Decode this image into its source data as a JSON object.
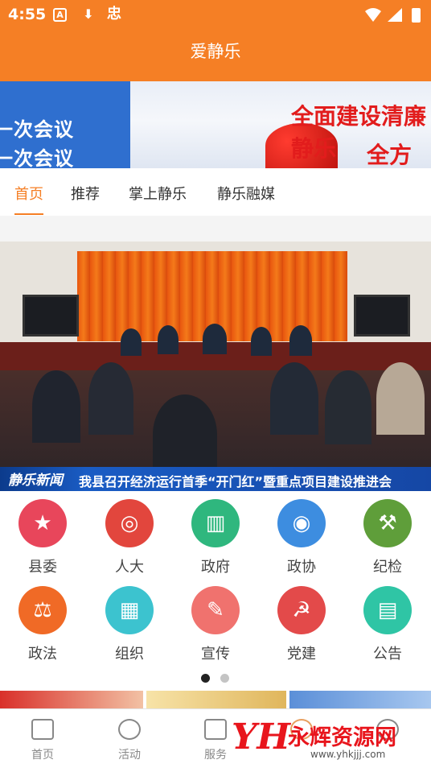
{
  "status_bar": {
    "time": "4:55",
    "icons": [
      "a-icon",
      "download-icon",
      "jian-icon",
      "wifi-icon",
      "signal-icon",
      "battery-icon"
    ],
    "jian_char": "忠"
  },
  "app": {
    "title": "爱静乐"
  },
  "banner": {
    "left_line1": "一次会议",
    "left_line2": "一次会议",
    "right_line1": "全面建设清廉静乐",
    "right_line2": "全方位推动静乐高"
  },
  "tabs": [
    {
      "label": "首页",
      "active": true
    },
    {
      "label": "推荐",
      "active": false
    },
    {
      "label": "掌上静乐",
      "active": false
    },
    {
      "label": "静乐融媒",
      "active": false
    }
  ],
  "news_photo": {
    "tag": "静乐新闻",
    "caption": "我县召开经济运行首季“开门红”暨重点项目建设推进会"
  },
  "grid": [
    {
      "label": "县委",
      "icon": "flag-icon",
      "color": "#e8465b",
      "glyph": "★"
    },
    {
      "label": "人大",
      "icon": "emblem-icon",
      "color": "#e2463d",
      "glyph": "◎"
    },
    {
      "label": "政府",
      "icon": "tiananmen-icon",
      "color": "#2fb77e",
      "glyph": "▥"
    },
    {
      "label": "政协",
      "icon": "cppcc-icon",
      "color": "#3d8de0",
      "glyph": "◉"
    },
    {
      "label": "纪检",
      "icon": "gavel-icon",
      "color": "#5f9e3a",
      "glyph": "⚒"
    },
    {
      "label": "政法",
      "icon": "scales-icon",
      "color": "#f06a26",
      "glyph": "⚖"
    },
    {
      "label": "组织",
      "icon": "puzzle-icon",
      "color": "#3cc3cf",
      "glyph": "▦"
    },
    {
      "label": "宣传",
      "icon": "pencil-icon",
      "color": "#f0726e",
      "glyph": "✎"
    },
    {
      "label": "党建",
      "icon": "hammer-sickle-icon",
      "color": "#e34a4a",
      "glyph": "☭"
    },
    {
      "label": "公告",
      "icon": "chat-icon",
      "color": "#2fc5a5",
      "glyph": "▤"
    }
  ],
  "pager": {
    "pages": 2,
    "current": 1
  },
  "bottom_nav": [
    {
      "label": "首页",
      "icon": "home-grid-icon"
    },
    {
      "label": "活动",
      "icon": "star-badge-icon"
    },
    {
      "label": "服务",
      "icon": "service-chat-icon"
    },
    {
      "label": "",
      "icon": "center-icon"
    },
    {
      "label": "",
      "icon": "mine-icon"
    }
  ],
  "watermark": {
    "logo": "YH",
    "text": "永辉资源网",
    "url": "www.yhkjjj.com"
  },
  "colors": {
    "accent": "#f57f25"
  }
}
